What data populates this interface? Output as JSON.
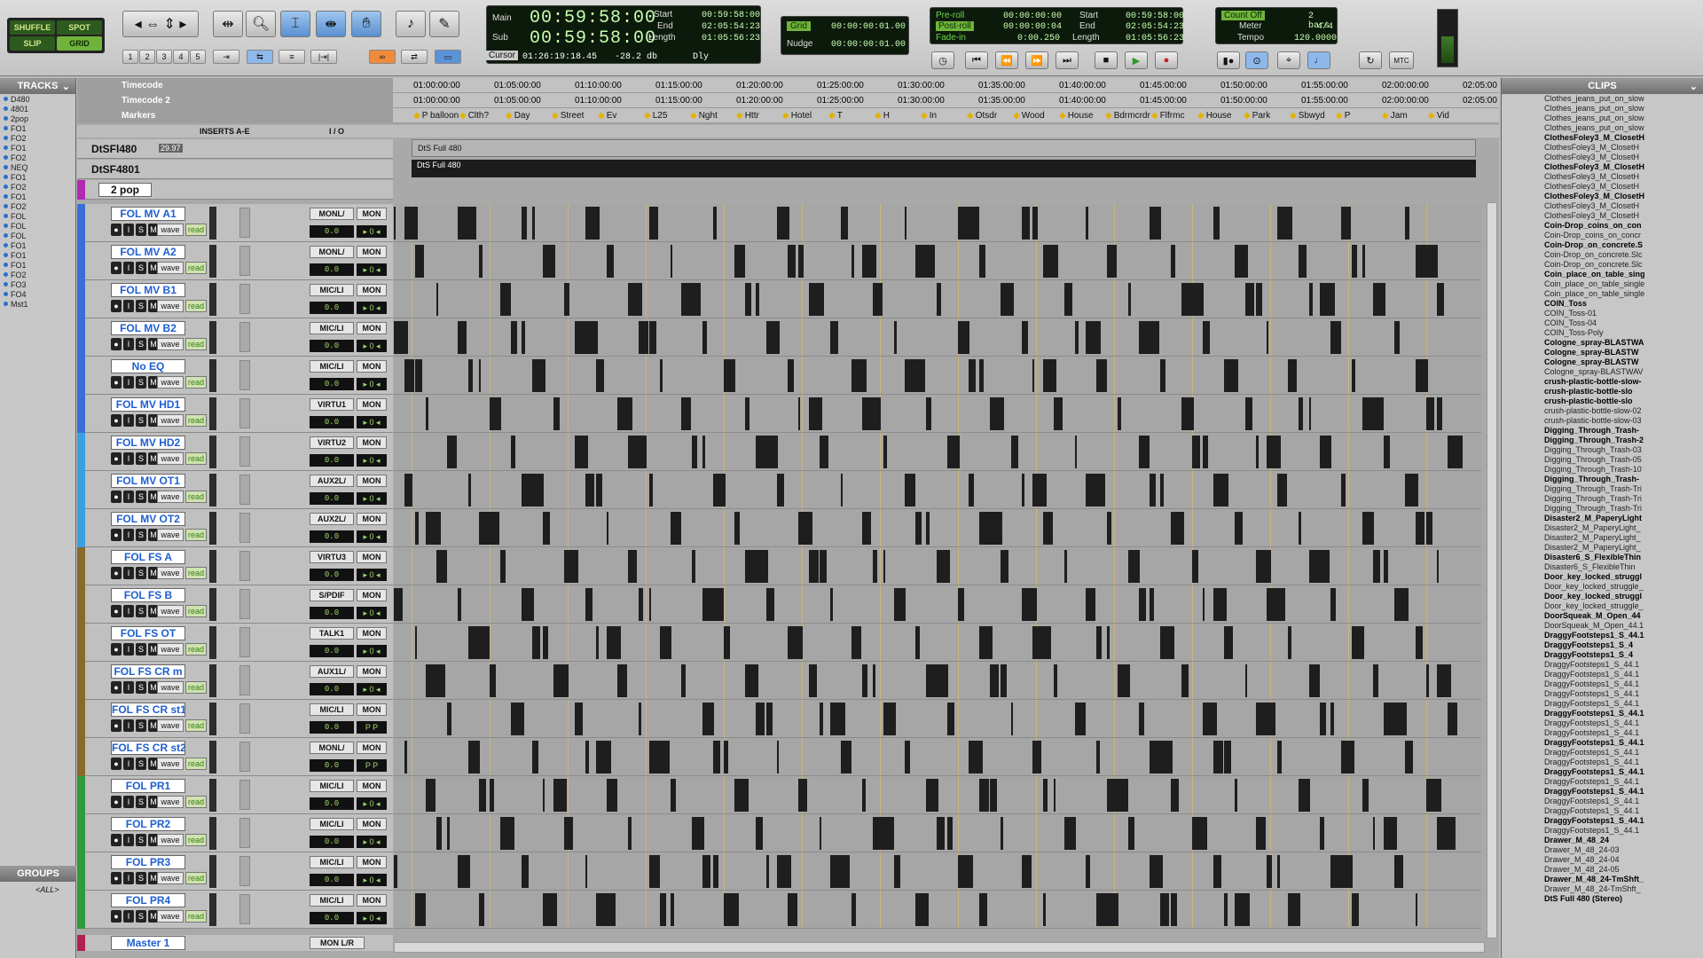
{
  "toolbar": {
    "modes": [
      "SHUFFLE",
      "SPOT",
      "SLIP",
      "GRID"
    ],
    "zoom_presets": [
      "1",
      "2",
      "3",
      "4",
      "5"
    ],
    "counter": {
      "main_label": "Main",
      "sub_label": "Sub",
      "main": "00:59:58:00",
      "sub": "00:59:58:00",
      "start_label": "Start",
      "end_label": "End",
      "length_label": "Length",
      "start": "00:59:58:00",
      "end": "02:05:54:23",
      "length": "01:05:56:23",
      "cursor_label": "Cursor",
      "cursor": "01:26:19:18.45",
      "cursor_db": "-28.2 db",
      "dly": "Dly"
    },
    "grid": {
      "grid_label": "Grid",
      "grid_value": "00:00:00:01.00",
      "nudge_label": "Nudge",
      "nudge_value": "00:00:00:01.00"
    },
    "transport_counter": {
      "preroll_label": "Pre-roll",
      "preroll": "00:00:00:00",
      "postroll_label": "Post-roll",
      "postroll": "00:00:00:04",
      "fadein_label": "Fade-in",
      "fadein": "0:00.250",
      "start_label": "Start",
      "start": "00:59:58:00",
      "end_label": "End",
      "end": "02:05:54:23",
      "length_label": "Length",
      "length": "01:05:56:23"
    },
    "meter": {
      "countoff_label": "Count Off",
      "countoff": "2 bars",
      "meter_label": "Meter",
      "meter": "4/4",
      "tempo_label": "Tempo",
      "tempo": "120.0000"
    },
    "mtc": "MTC"
  },
  "tracks_panel": {
    "title": "TRACKS",
    "items": [
      "D480",
      "4801",
      "2pop",
      "FO1",
      "FO2",
      "FO1",
      "FO2",
      "NEQ",
      "FO1",
      "FO2",
      "FO1",
      "FO2",
      "FOL",
      "FOL",
      "FOL",
      "FO1",
      "FO1",
      "FO1",
      "FO2",
      "FO3",
      "FO4",
      "Mst1"
    ],
    "groups_title": "GROUPS",
    "groups_all": "<ALL>"
  },
  "rulers": {
    "timecode": "Timecode",
    "timecode2": "Timecode 2",
    "markers": "Markers",
    "ticks1": [
      "01:00:00:00",
      "01:05:00:00",
      "01:10:00:00",
      "01:15:00:00",
      "01:20:00:00",
      "01:25:00:00",
      "01:30:00:00",
      "01:35:00:00",
      "01:40:00:00",
      "01:45:00:00",
      "01:50:00:00",
      "01:55:00:00",
      "02:00:00:00",
      "02:05:00"
    ],
    "ticks2": [
      "01:00:00:00",
      "01:05:00:00",
      "01:10:00:00",
      "01:15:00:00",
      "01:20:00:00",
      "01:25:00:00",
      "01:30:00:00",
      "01:35:00:00",
      "01:40:00:00",
      "01:45:00:00",
      "01:50:00:00",
      "01:55:00:00",
      "02:00:00:00",
      "02:05:00"
    ],
    "marker_names": [
      "P balloon",
      "Clth?",
      "Day",
      "Street",
      "Ev",
      "L25",
      "Nght",
      "Httr",
      "Hotel",
      "T",
      "H",
      "In",
      "Otsdr",
      "Wood",
      "House",
      "Bdrmcrdr",
      "Flfrmc",
      "House",
      "Park",
      "Sbwyd",
      "P",
      "Jam",
      "Vid"
    ]
  },
  "column_headers": {
    "inserts": "INSERTS A-E",
    "io": "I / O"
  },
  "video_tracks": [
    {
      "name": "DtSFl480",
      "rate": "29.97",
      "clip": "DtS Full 480"
    },
    {
      "name": "DtSF4801",
      "clip": "DtS Full 480"
    },
    {
      "name": "2 pop"
    }
  ],
  "tracks": [
    {
      "name": "FOL MV A1",
      "io": "MONL/",
      "mon": "MON",
      "vol": "0.0",
      "pan": "▸ 0 ◂",
      "color": "#3a6fd8"
    },
    {
      "name": "FOL MV A2",
      "io": "MONL/",
      "mon": "MON",
      "vol": "0.0",
      "pan": "▸ 0 ◂",
      "color": "#3a6fd8"
    },
    {
      "name": "FOL MV B1",
      "io": "MIC/LI",
      "mon": "MON",
      "vol": "0.0",
      "pan": "▸ 0 ◂",
      "color": "#3a6fd8"
    },
    {
      "name": "FOL MV B2",
      "io": "MIC/LI",
      "mon": "MON",
      "vol": "0.0",
      "pan": "▸ 0 ◂",
      "color": "#3a6fd8"
    },
    {
      "name": "No EQ",
      "io": "MIC/LI",
      "mon": "MON",
      "vol": "0.0",
      "pan": "▸ 0 ◂",
      "color": "#3a6fd8"
    },
    {
      "name": "FOL MV HD1",
      "io": "VIRTU1",
      "mon": "MON",
      "vol": "0.0",
      "pan": "▸ 0 ◂",
      "color": "#3a6fd8"
    },
    {
      "name": "FOL MV HD2",
      "io": "VIRTU2",
      "mon": "MON",
      "vol": "0.0",
      "pan": "▸ 0 ◂",
      "color": "#3aa0e0"
    },
    {
      "name": "FOL MV OT1",
      "io": "AUX2L/",
      "mon": "MON",
      "vol": "0.0",
      "pan": "▸ 0 ◂",
      "color": "#3aa0e0"
    },
    {
      "name": "FOL MV OT2",
      "io": "AUX2L/",
      "mon": "MON",
      "vol": "0.0",
      "pan": "▸ 0 ◂",
      "color": "#3aa0e0"
    },
    {
      "name": "FOL FS A",
      "io": "VIRTU3",
      "mon": "MON",
      "vol": "0.0",
      "pan": "▸ 0 ◂",
      "color": "#8a6a2a"
    },
    {
      "name": "FOL FS B",
      "io": "S/PDIF",
      "mon": "MON",
      "vol": "0.0",
      "pan": "▸ 0 ◂",
      "color": "#8a6a2a"
    },
    {
      "name": "FOL FS OT",
      "io": "TALK1",
      "mon": "MON",
      "vol": "0.0",
      "pan": "▸ 0 ◂",
      "color": "#8a6a2a"
    },
    {
      "name": "FOL FS CR m",
      "io": "AUX1L/",
      "mon": "MON",
      "vol": "0.0",
      "pan": "▸ 0 ◂",
      "color": "#8a6a2a"
    },
    {
      "name": "FOL FS CR st1",
      "io": "MIC/LI",
      "mon": "MON",
      "vol": "0.0",
      "pan": "P P",
      "color": "#8a6a2a"
    },
    {
      "name": "FOL FS CR st2",
      "io": "MONL/",
      "mon": "MON",
      "vol": "0.0",
      "pan": "P P",
      "color": "#8a6a2a"
    },
    {
      "name": "FOL PR1",
      "io": "MIC/LI",
      "mon": "MON",
      "vol": "0.0",
      "pan": "▸ 0 ◂",
      "color": "#2f9a3a"
    },
    {
      "name": "FOL PR2",
      "io": "MIC/LI",
      "mon": "MON",
      "vol": "0.0",
      "pan": "▸ 0 ◂",
      "color": "#2f9a3a"
    },
    {
      "name": "FOL PR3",
      "io": "MIC/LI",
      "mon": "MON",
      "vol": "0.0",
      "pan": "▸ 0 ◂",
      "color": "#2f9a3a"
    },
    {
      "name": "FOL PR4",
      "io": "MIC/LI",
      "mon": "MON",
      "vol": "0.0",
      "pan": "▸ 0 ◂",
      "color": "#2f9a3a"
    }
  ],
  "master": {
    "name": "Master 1",
    "io": "MON L/R"
  },
  "track_buttons": {
    "rec": "●",
    "input": "I",
    "solo": "S",
    "mute": "M",
    "view": "wave",
    "auto": "read"
  },
  "clips_panel": {
    "title": "CLIPS",
    "items": [
      {
        "t": "Clothes_jeans_put_on_slow",
        "b": false
      },
      {
        "t": "Clothes_jeans_put_on_slow",
        "b": false
      },
      {
        "t": "Clothes_jeans_put_on_slow",
        "b": false
      },
      {
        "t": "Clothes_jeans_put_on_slow",
        "b": false
      },
      {
        "t": "ClothesFoley3_M_ClosetH",
        "b": true
      },
      {
        "t": "ClothesFoley3_M_ClosetH",
        "b": false
      },
      {
        "t": "ClothesFoley3_M_ClosetH",
        "b": false
      },
      {
        "t": "ClothesFoley3_M_ClosetH",
        "b": true
      },
      {
        "t": "ClothesFoley3_M_ClosetH",
        "b": false
      },
      {
        "t": "ClothesFoley3_M_ClosetH",
        "b": false
      },
      {
        "t": "ClothesFoley3_M_ClosetH",
        "b": true
      },
      {
        "t": "ClothesFoley3_M_ClosetH",
        "b": false
      },
      {
        "t": "ClothesFoley3_M_ClosetH",
        "b": false
      },
      {
        "t": "Coin-Drop_coins_on_con",
        "b": true
      },
      {
        "t": "Coin-Drop_coins_on_concr",
        "b": false
      },
      {
        "t": "Coin-Drop_on_concrete.S",
        "b": true
      },
      {
        "t": "Coin-Drop_on_concrete.Slc",
        "b": false
      },
      {
        "t": "Coin-Drop_on_concrete.Slc",
        "b": false
      },
      {
        "t": "Coin_place_on_table_sing",
        "b": true
      },
      {
        "t": "Coin_place_on_table_single",
        "b": false
      },
      {
        "t": "Coin_place_on_table_single",
        "b": false
      },
      {
        "t": "COIN_Toss",
        "b": true
      },
      {
        "t": "COIN_Toss-01",
        "b": false
      },
      {
        "t": "COIN_Toss-04",
        "b": false
      },
      {
        "t": "COIN_Toss-Poly",
        "b": false
      },
      {
        "t": "Cologne_spray-BLASTWA",
        "b": true
      },
      {
        "t": "Cologne_spray-BLASTW",
        "b": true
      },
      {
        "t": "Cologne_spray-BLASTW",
        "b": true
      },
      {
        "t": "Cologne_spray-BLASTWAV",
        "b": false
      },
      {
        "t": "crush-plastic-bottle-slow-",
        "b": true
      },
      {
        "t": "crush-plastic-bottle-slo",
        "b": true
      },
      {
        "t": "crush-plastic-bottle-slo",
        "b": true
      },
      {
        "t": "crush-plastic-bottle-slow-02",
        "b": false
      },
      {
        "t": "crush-plastic-bottle-slow-03",
        "b": false
      },
      {
        "t": "Digging_Through_Trash-",
        "b": true
      },
      {
        "t": "Digging_Through_Trash-2",
        "b": true
      },
      {
        "t": "Digging_Through_Trash-03",
        "b": false
      },
      {
        "t": "Digging_Through_Trash-05",
        "b": false
      },
      {
        "t": "Digging_Through_Trash-10",
        "b": false
      },
      {
        "t": "Digging_Through_Trash-",
        "b": true
      },
      {
        "t": "Digging_Through_Trash-Tri",
        "b": false
      },
      {
        "t": "Digging_Through_Trash-Tri",
        "b": false
      },
      {
        "t": "Digging_Through_Trash-Tri",
        "b": false
      },
      {
        "t": "Disaster2_M_PaperyLight",
        "b": true
      },
      {
        "t": "Disaster2_M_PaperyLight_",
        "b": false
      },
      {
        "t": "Disaster2_M_PaperyLight_",
        "b": false
      },
      {
        "t": "Disaster2_M_PaperyLight_",
        "b": false
      },
      {
        "t": "Disaster6_S_FlexibleThin",
        "b": true
      },
      {
        "t": "Disaster6_S_FlexibleThin",
        "b": false
      },
      {
        "t": "Door_key_locked_struggl",
        "b": true
      },
      {
        "t": "Door_key_locked_struggle_",
        "b": false
      },
      {
        "t": "Door_key_locked_struggl",
        "b": true
      },
      {
        "t": "Door_key_locked_struggle_",
        "b": false
      },
      {
        "t": "DoorSqueak_M_Open_44",
        "b": true
      },
      {
        "t": "DoorSqueak_M_Open_44.1",
        "b": false
      },
      {
        "t": "DraggyFootsteps1_S_44.1",
        "b": true
      },
      {
        "t": "DraggyFootsteps1_S_4",
        "b": true
      },
      {
        "t": "DraggyFootsteps1_S_4",
        "b": true
      },
      {
        "t": "DraggyFootsteps1_S_44.1",
        "b": false
      },
      {
        "t": "DraggyFootsteps1_S_44.1",
        "b": false
      },
      {
        "t": "DraggyFootsteps1_S_44.1",
        "b": false
      },
      {
        "t": "DraggyFootsteps1_S_44.1",
        "b": false
      },
      {
        "t": "DraggyFootsteps1_S_44.1",
        "b": false
      },
      {
        "t": "DraggyFootsteps1_S_44.1",
        "b": true
      },
      {
        "t": "DraggyFootsteps1_S_44.1",
        "b": false
      },
      {
        "t": "DraggyFootsteps1_S_44.1",
        "b": false
      },
      {
        "t": "DraggyFootsteps1_S_44.1",
        "b": true
      },
      {
        "t": "DraggyFootsteps1_S_44.1",
        "b": false
      },
      {
        "t": "DraggyFootsteps1_S_44.1",
        "b": false
      },
      {
        "t": "DraggyFootsteps1_S_44.1",
        "b": true
      },
      {
        "t": "DraggyFootsteps1_S_44.1",
        "b": false
      },
      {
        "t": "DraggyFootsteps1_S_44.1",
        "b": true
      },
      {
        "t": "DraggyFootsteps1_S_44.1",
        "b": false
      },
      {
        "t": "DraggyFootsteps1_S_44.1",
        "b": false
      },
      {
        "t": "DraggyFootsteps1_S_44.1",
        "b": true
      },
      {
        "t": "DraggyFootsteps1_S_44.1",
        "b": false
      },
      {
        "t": "Drawer_M_48_24",
        "b": true
      },
      {
        "t": "Drawer_M_48_24-03",
        "b": false
      },
      {
        "t": "Drawer_M_48_24-04",
        "b": false
      },
      {
        "t": "Drawer_M_48_24-05",
        "b": false
      },
      {
        "t": "Drawer_M_48_24-TmShft_",
        "b": true
      },
      {
        "t": "Drawer_M_48_24-TmShft_",
        "b": false
      },
      {
        "t": "DtS Full 480 (Stereo)",
        "b": true
      }
    ]
  }
}
